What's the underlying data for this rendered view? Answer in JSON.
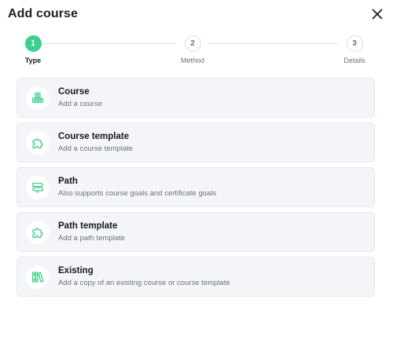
{
  "dialog": {
    "title": "Add course"
  },
  "stepper": {
    "steps": [
      {
        "number": "1",
        "label": "Type",
        "state": "active"
      },
      {
        "number": "2",
        "label": "Method",
        "state": "inactive"
      },
      {
        "number": "3",
        "label": "Details",
        "state": "inactive"
      }
    ]
  },
  "options": [
    {
      "title": "Course",
      "description": "Add a course",
      "icon": "cubes-icon"
    },
    {
      "title": "Course template",
      "description": "Add a course template",
      "icon": "puzzle-icon"
    },
    {
      "title": "Path",
      "description": "Also supports course goals and certificate goals",
      "icon": "signpost-icon"
    },
    {
      "title": "Path template",
      "description": "Add a path template",
      "icon": "puzzle-icon"
    },
    {
      "title": "Existing",
      "description": "Add a copy of an existing course or course template",
      "icon": "books-icon"
    }
  ],
  "colors": {
    "accent": "#3ecf8e",
    "card_bg": "#f4f5f9"
  }
}
